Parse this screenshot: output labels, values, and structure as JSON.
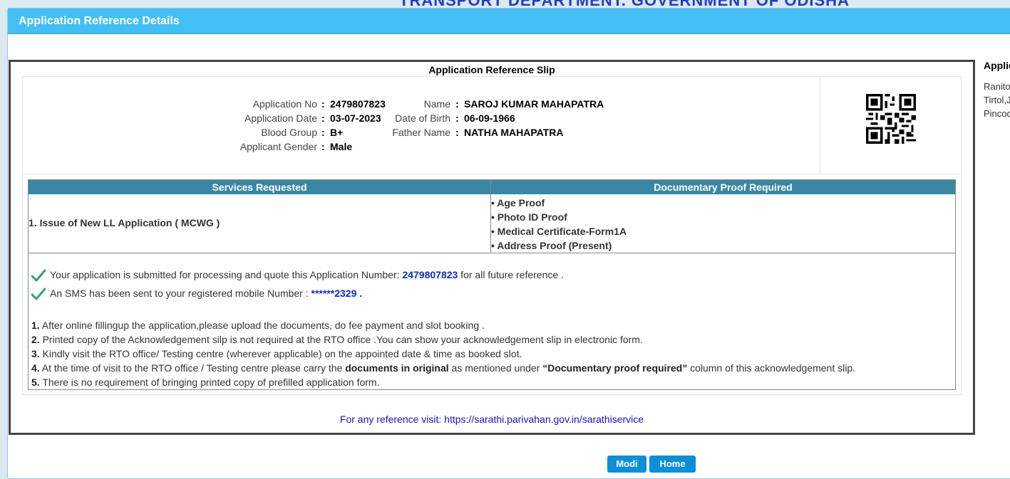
{
  "banner": "TRANSPORT DEPARTMENT, GOVERNMENT OF ODISHA",
  "panel": {
    "title": "Application Reference Details"
  },
  "slip": {
    "title": "Application Reference Slip",
    "fields": {
      "app_no_label": "Application No",
      "app_no": "2479807823",
      "app_date_label": "Application Date",
      "app_date": "03-07-2023",
      "blood_label": "Blood Group",
      "blood": "B+",
      "gender_label": "Applicant Gender",
      "gender": "Male",
      "name_label": "Name",
      "name": "SAROJ KUMAR MAHAPATRA",
      "dob_label": "Date of Birth",
      "dob": "06-09-1966",
      "father_label": "Father Name",
      "father": "NATHA MAHAPATRA",
      "colon": ":"
    },
    "services": {
      "col1_header": "Services Requested",
      "col2_header": "Documentary Proof Required",
      "service": "1. Issue of New LL Application ( MCWG )",
      "proofs": [
        "• Age Proof",
        "• Photo ID Proof",
        "• Medical Certificate-Form1A",
        "• Address Proof (Present)"
      ]
    },
    "messages": {
      "submitted_pre": "Your application is submitted for processing and quote this Application Number: ",
      "submitted_num": "2479807823",
      "submitted_post": " for all future reference .",
      "sms_pre": "An SMS has been sent to your registered mobile Number : ",
      "sms_num": "******2329 ."
    },
    "notes": [
      {
        "num": "1.",
        "text": " After online fillingup the application,please upload the documents, do fee payment and slot booking ."
      },
      {
        "num": "2.",
        "text": " Printed copy of the Acknowledgement silp is not required at the RTO office .You can show your acknowledgement slip in electronic form."
      },
      {
        "num": "3.",
        "text": " Kindly visit the RTO office/ Testing centre (wherever applicable) on the appointed date & time as booked slot."
      },
      {
        "num": "5.",
        "text": " There is no requirement of bringing printed copy of prefilled application form."
      }
    ],
    "note4": {
      "num": "4.",
      "pre": " At the time of visit to the RTO office / Testing centre please carry the ",
      "bold1": "documents in original",
      "mid": " as mentioned under ",
      "bold2": "“Documentary proof required”",
      "post": " column of this acknowledgement slip."
    },
    "reference_link": "For any reference visit: https://sarathi.parivahan.gov.in/sarathiservice"
  },
  "side": {
    "title": "Applic",
    "lines": [
      "Ranito",
      "Tirtol,J",
      "Pincod"
    ]
  },
  "buttons": {
    "first": "Modi",
    "second": "Home"
  },
  "colors": {
    "header": "#44bff5",
    "table_head": "#3a87a4",
    "highlight": "#0b2fc4",
    "link": "#1414c8"
  }
}
